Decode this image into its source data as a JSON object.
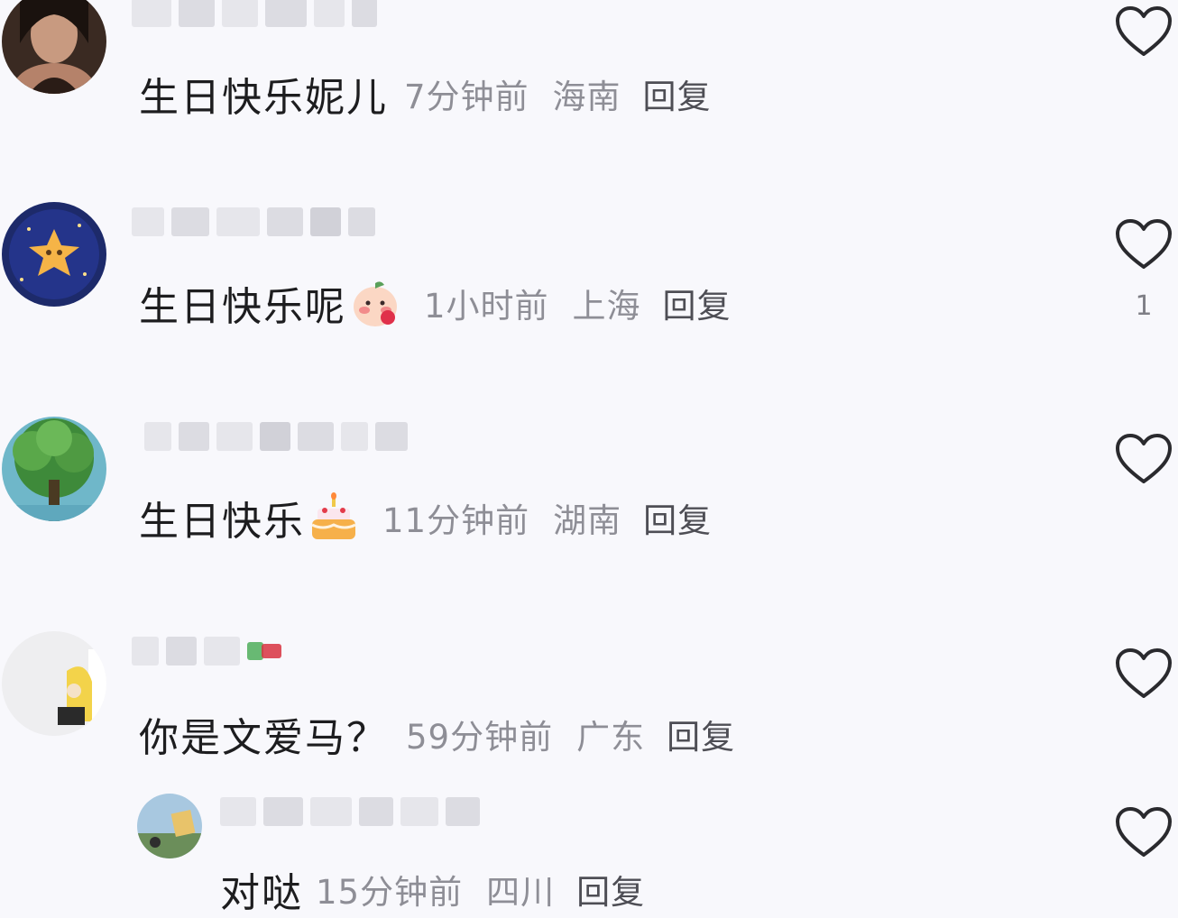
{
  "comments": [
    {
      "text": "生日快乐妮儿",
      "time": "7分钟前",
      "location": "海南",
      "reply_label": "回复",
      "like_count": ""
    },
    {
      "text": "生日快乐呢",
      "emoji": "blushing-face-emoji",
      "time": "1小时前",
      "location": "上海",
      "reply_label": "回复",
      "like_count": "1"
    },
    {
      "text": "生日快乐",
      "emoji": "birthday-cake-emoji",
      "time": "11分钟前",
      "location": "湖南",
      "reply_label": "回复",
      "like_count": ""
    },
    {
      "text": "你是文爱马？",
      "time": "59分钟前",
      "location": "广东",
      "reply_label": "回复",
      "like_count": "",
      "replies": [
        {
          "text": "对哒",
          "time": "15分钟前",
          "location": "四川",
          "reply_label": "回复",
          "like_count": ""
        }
      ]
    }
  ],
  "icons": {
    "like": "heart-outline-icon"
  },
  "colors": {
    "background": "#f8f8fc",
    "text": "#1d1d1f",
    "meta": "#8e8e96"
  }
}
